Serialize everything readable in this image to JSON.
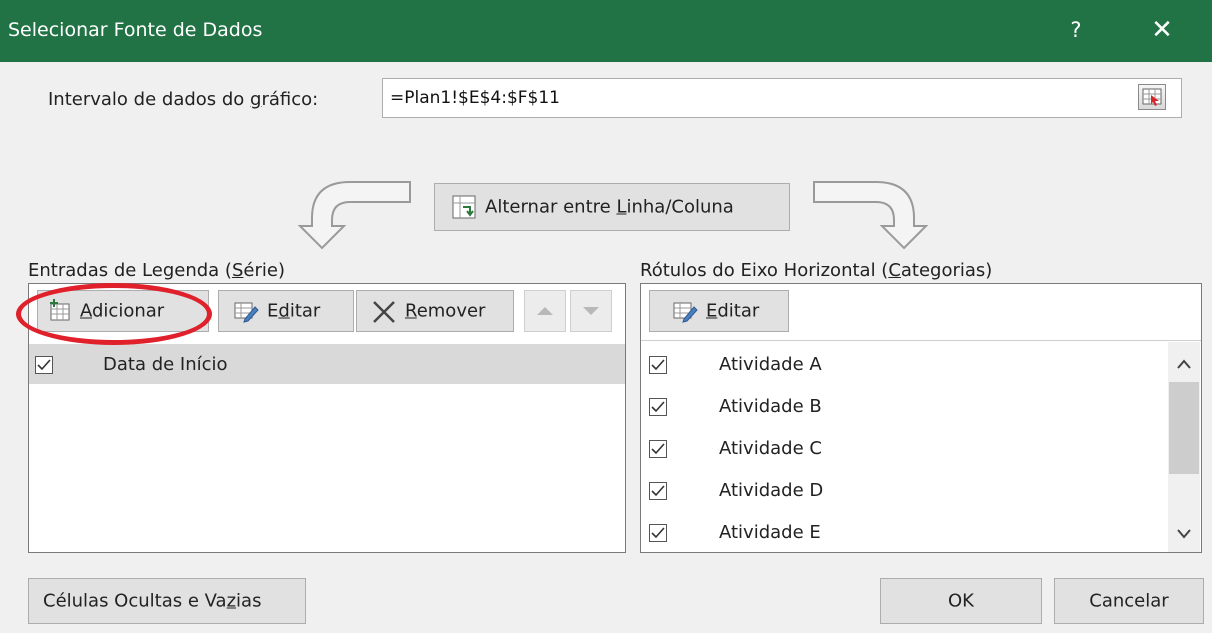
{
  "window": {
    "title": "Selecionar Fonte de Dados",
    "help": "?",
    "close": "✕",
    "accent": "#217346"
  },
  "range": {
    "label_pre": "Intervalo de dados do ",
    "label_u": "g",
    "label_post": "ráfico:",
    "value": "=Plan1!$E$4:$F$11"
  },
  "swap": {
    "pre": "Alternar entre ",
    "u": "L",
    "post": "inha/Coluna"
  },
  "legend": {
    "label_pre": "Entradas de Legenda (",
    "label_u": "S",
    "label_post": "érie)",
    "add": {
      "u": "A",
      "rest": "dicionar"
    },
    "edit": {
      "pre": "E",
      "u": "d",
      "post": "itar"
    },
    "remove": {
      "u": "R",
      "rest": "emover"
    },
    "items": [
      {
        "label": "Data de Início",
        "checked": true
      }
    ]
  },
  "axis": {
    "label_pre": "Rótulos do Eixo Horizontal (",
    "label_u": "C",
    "label_post": "ategorias)",
    "edit": {
      "u": "E",
      "rest": "ditar"
    },
    "items": [
      {
        "label": "Atividade A",
        "checked": true
      },
      {
        "label": "Atividade B",
        "checked": true
      },
      {
        "label": "Atividade C",
        "checked": true
      },
      {
        "label": "Atividade D",
        "checked": true
      },
      {
        "label": "Atividade E",
        "checked": true
      }
    ]
  },
  "footer": {
    "hidden_pre": "Células Ocultas e Va",
    "hidden_u": "z",
    "hidden_post": "ias",
    "ok": "OK",
    "cancel": "Cancelar"
  }
}
